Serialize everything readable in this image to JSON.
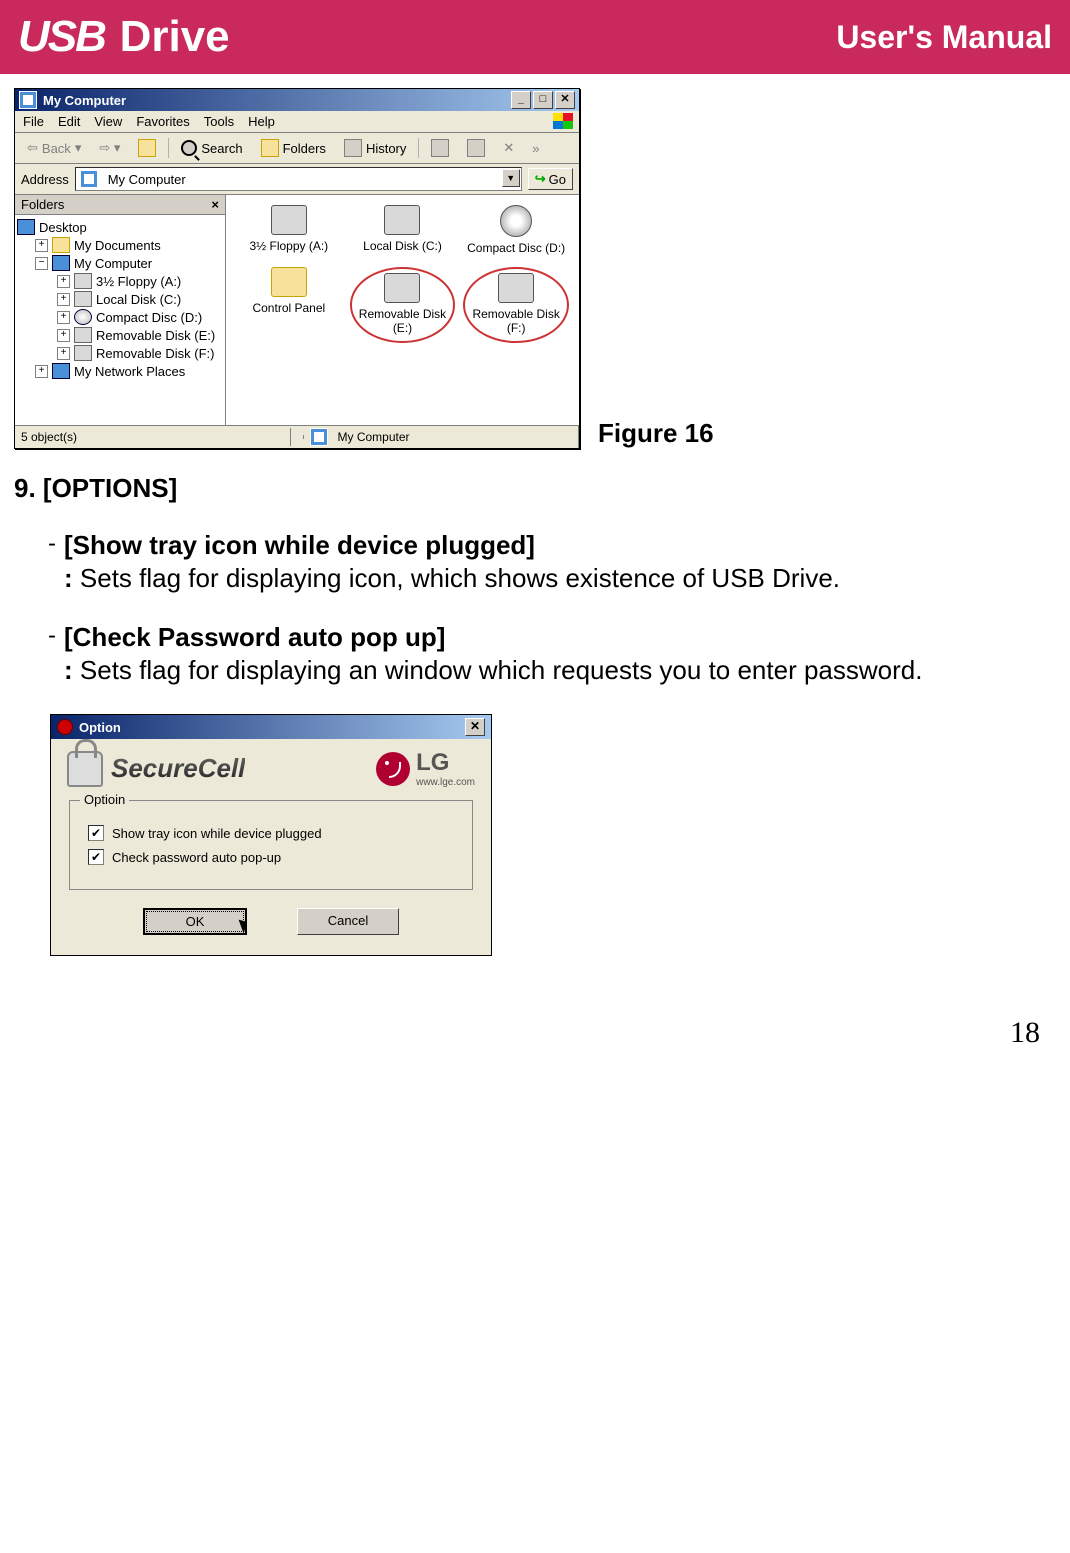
{
  "header": {
    "logo_left": "USB",
    "logo_right": "Drive",
    "manual": "User's Manual"
  },
  "figure_label": "Figure 16",
  "mycomputer": {
    "title": "My Computer",
    "menu": [
      "File",
      "Edit",
      "View",
      "Favorites",
      "Tools",
      "Help"
    ],
    "toolbar": {
      "back": "Back",
      "search": "Search",
      "folders": "Folders",
      "history": "History"
    },
    "address_label": "Address",
    "address_value": "My Computer",
    "go": "Go",
    "folders_title": "Folders",
    "tree": {
      "desktop": "Desktop",
      "mydocs": "My Documents",
      "mycomp": "My Computer",
      "floppy": "3½ Floppy (A:)",
      "local": "Local Disk (C:)",
      "cd": "Compact Disc (D:)",
      "reme": "Removable Disk (E:)",
      "remf": "Removable Disk (F:)",
      "network": "My Network Places"
    },
    "items": {
      "floppy": "3½ Floppy (A:)",
      "local": "Local Disk (C:)",
      "cd": "Compact Disc (D:)",
      "cp": "Control Panel",
      "reme": "Removable Disk (E:)",
      "remf": "Removable Disk (F:)"
    },
    "status_left": "5 object(s)",
    "status_right": "My Computer"
  },
  "section_title": "9. [OPTIONS]",
  "options": {
    "item1_title": "[Show tray icon while device plugged]",
    "item1_desc": "Sets flag for displaying icon, which shows existence of USB Drive.",
    "item2_title": "[Check Password auto pop up]",
    "item2_desc": "Sets flag for displaying an window which requests you to enter password."
  },
  "dialog": {
    "title": "Option",
    "brand": "SecureCell",
    "lg": "LG",
    "lg_url": "www.lge.com",
    "group": "Optioin",
    "chk1": "Show tray icon while device plugged",
    "chk2": "Check password auto pop-up",
    "ok": "OK",
    "cancel": "Cancel"
  },
  "page_number": "18"
}
